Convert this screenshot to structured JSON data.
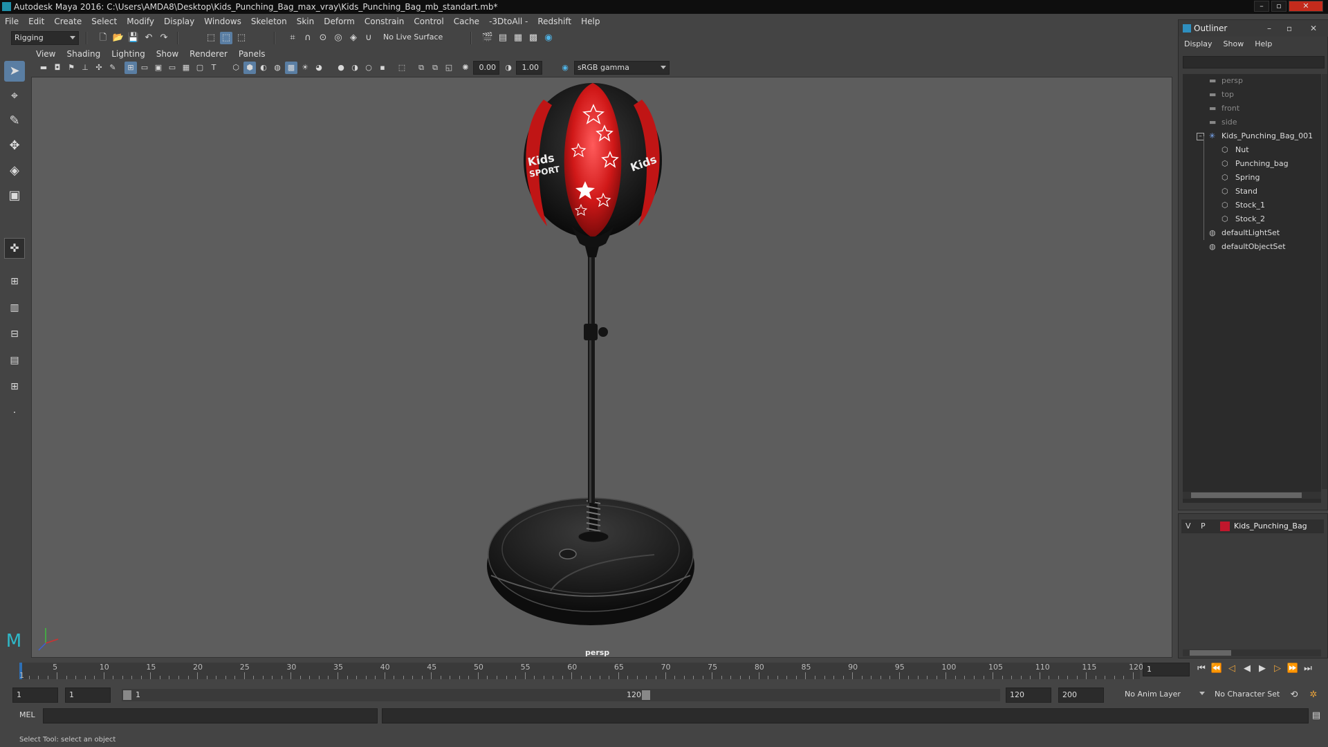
{
  "app": {
    "title": "Autodesk Maya 2016: C:\\Users\\AMDA8\\Desktop\\Kids_Punching_Bag_max_vray\\Kids_Punching_Bag_mb_standart.mb*"
  },
  "menubar": [
    "File",
    "Edit",
    "Create",
    "Select",
    "Modify",
    "Display",
    "Windows",
    "Skeleton",
    "Skin",
    "Deform",
    "Constrain",
    "Control",
    "Cache",
    "-3DtoAll -",
    "Redshift",
    "Help"
  ],
  "shelf": {
    "mode": "Rigging",
    "live_surface": "No Live Surface"
  },
  "viewport": {
    "menus": [
      "View",
      "Shading",
      "Lighting",
      "Show",
      "Renderer",
      "Panels"
    ],
    "exposure": "0.00",
    "gamma": "1.00",
    "color_space": "sRGB gamma",
    "camera_label": "persp"
  },
  "outliner": {
    "title": "Outliner",
    "menus": [
      "Display",
      "Show",
      "Help"
    ],
    "cameras": [
      "persp",
      "top",
      "front",
      "side"
    ],
    "group": "Kids_Punching_Bag_001",
    "children": [
      "Nut",
      "Punching_bag",
      "Spring",
      "Stand",
      "Stock_1",
      "Stock_2"
    ],
    "sets": [
      "defaultLightSet",
      "defaultObjectSet"
    ]
  },
  "layers": {
    "v": "V",
    "p": "P",
    "layer_name": "Kids_Punching_Bag",
    "layer_color": "#c0172c"
  },
  "timeline": {
    "ticks": [
      "5",
      "10",
      "15",
      "20",
      "25",
      "30",
      "35",
      "40",
      "45",
      "50",
      "55",
      "60",
      "65",
      "70",
      "75",
      "80",
      "85",
      "90",
      "95",
      "100",
      "105",
      "110",
      "115",
      "120"
    ],
    "current_frame": "1",
    "first_label": "1"
  },
  "range": {
    "start": "1",
    "start2": "1",
    "slider_start": "1",
    "slider_end": "120",
    "end": "120",
    "end2": "200",
    "anim_layer": "No Anim Layer",
    "char_set": "No Character Set"
  },
  "command": {
    "lang": "MEL"
  },
  "helpline": "Select Tool: select an object"
}
